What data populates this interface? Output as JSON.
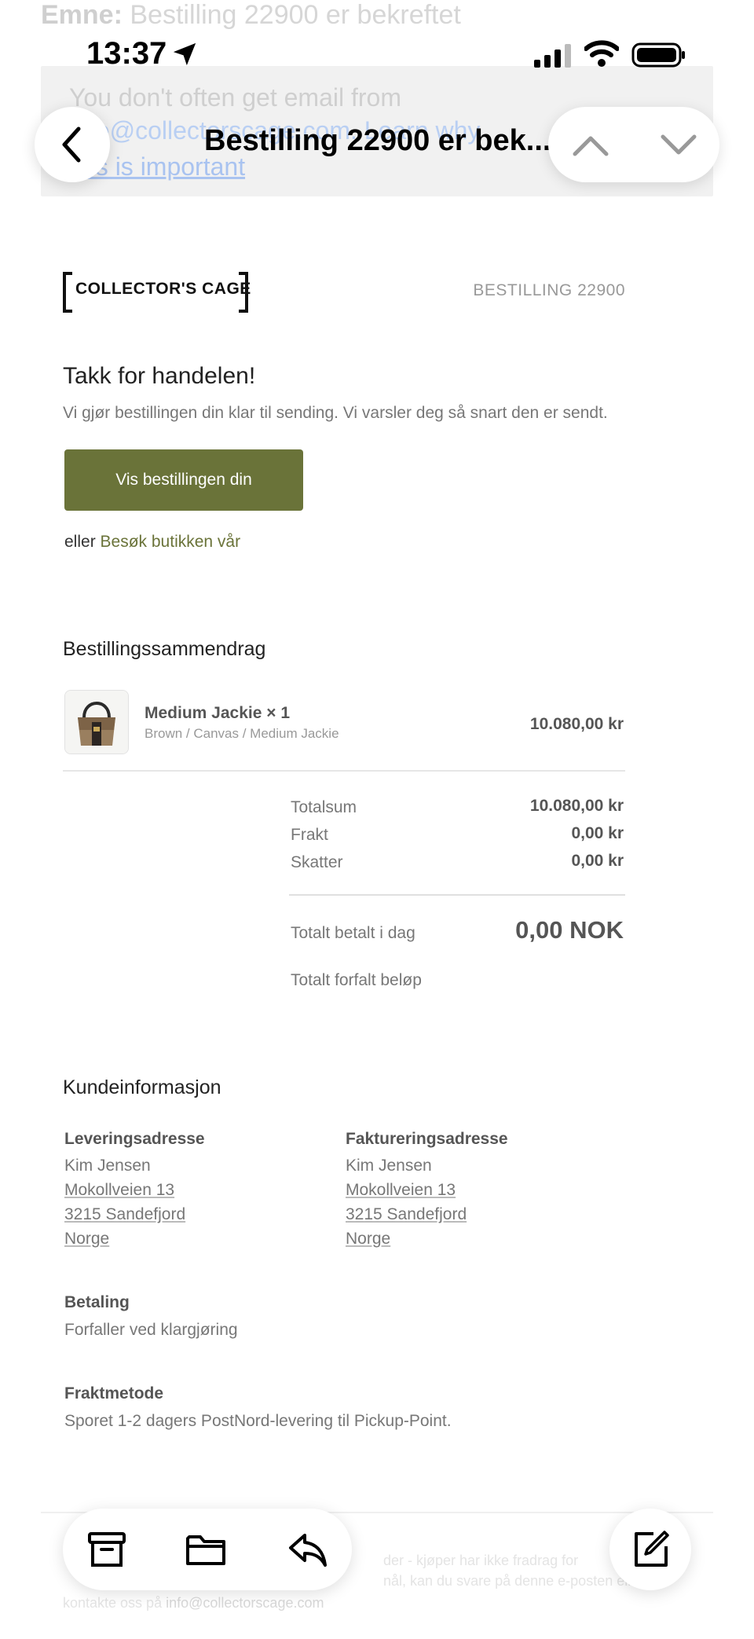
{
  "background": {
    "subject_label": "Emne:",
    "subject_text": "Bestilling 22900 er bekreftet",
    "notice_line1": "You don't often get email from",
    "notice_line2": "info@collectorscage.com. Learn why",
    "notice_line3": "this is important"
  },
  "status_bar": {
    "time": "13:37"
  },
  "nav": {
    "title": "Bestilling 22900 er bek..."
  },
  "email": {
    "brand": "COLLECTOR'S CAGE",
    "order_number": "BESTILLING 22900",
    "heading": "Takk for handelen!",
    "intro": "Vi gjør bestillingen din klar til sending. Vi varsler deg så snart den er sendt.",
    "cta_label": "Vis bestillingen din",
    "or_text": "eller",
    "store_link": "Besøk butikken vår",
    "summary": {
      "title": "Bestillingssammendrag",
      "item_name": "Medium Jackie × 1",
      "item_variant": "Brown / Canvas / Medium Jackie",
      "item_price": "10.080,00 kr",
      "subtotal_label": "Totalsum",
      "subtotal_value": "10.080,00 kr",
      "shipping_label": "Frakt",
      "shipping_value": "0,00 kr",
      "tax_label": "Skatter",
      "tax_value": "0,00 kr",
      "paid_label": "Totalt betalt i dag",
      "paid_value": "0,00 NOK",
      "due_label": "Totalt forfalt beløp"
    },
    "customer": {
      "title": "Kundeinformasjon",
      "shipping_heading": "Leveringsadresse",
      "billing_heading": "Faktureringsadresse",
      "shipping": [
        "Kim Jensen",
        "Mokollveien 13",
        "3215 Sandefjord",
        "Norge"
      ],
      "billing": [
        "Kim Jensen",
        "Mokollveien 13",
        "3215 Sandefjord",
        "Norge"
      ],
      "payment_heading": "Betaling",
      "payment_value": "Forfaller ved klargjøring",
      "shipping_method_heading": "Fraktmetode",
      "shipping_method_value": "Sporet 1-2 dagers PostNord-levering til Pickup-Point."
    },
    "footer": {
      "line1": "der - kjøper har ikke fradrag for",
      "line2": "nål, kan du svare på denne e-posten eller",
      "line3_prefix": "kontakte oss på",
      "email": "info@collectorscage.com"
    }
  },
  "toolbar": {
    "archive": "archive-icon",
    "folder": "folder-icon",
    "reply": "reply-icon",
    "compose": "compose-icon"
  }
}
